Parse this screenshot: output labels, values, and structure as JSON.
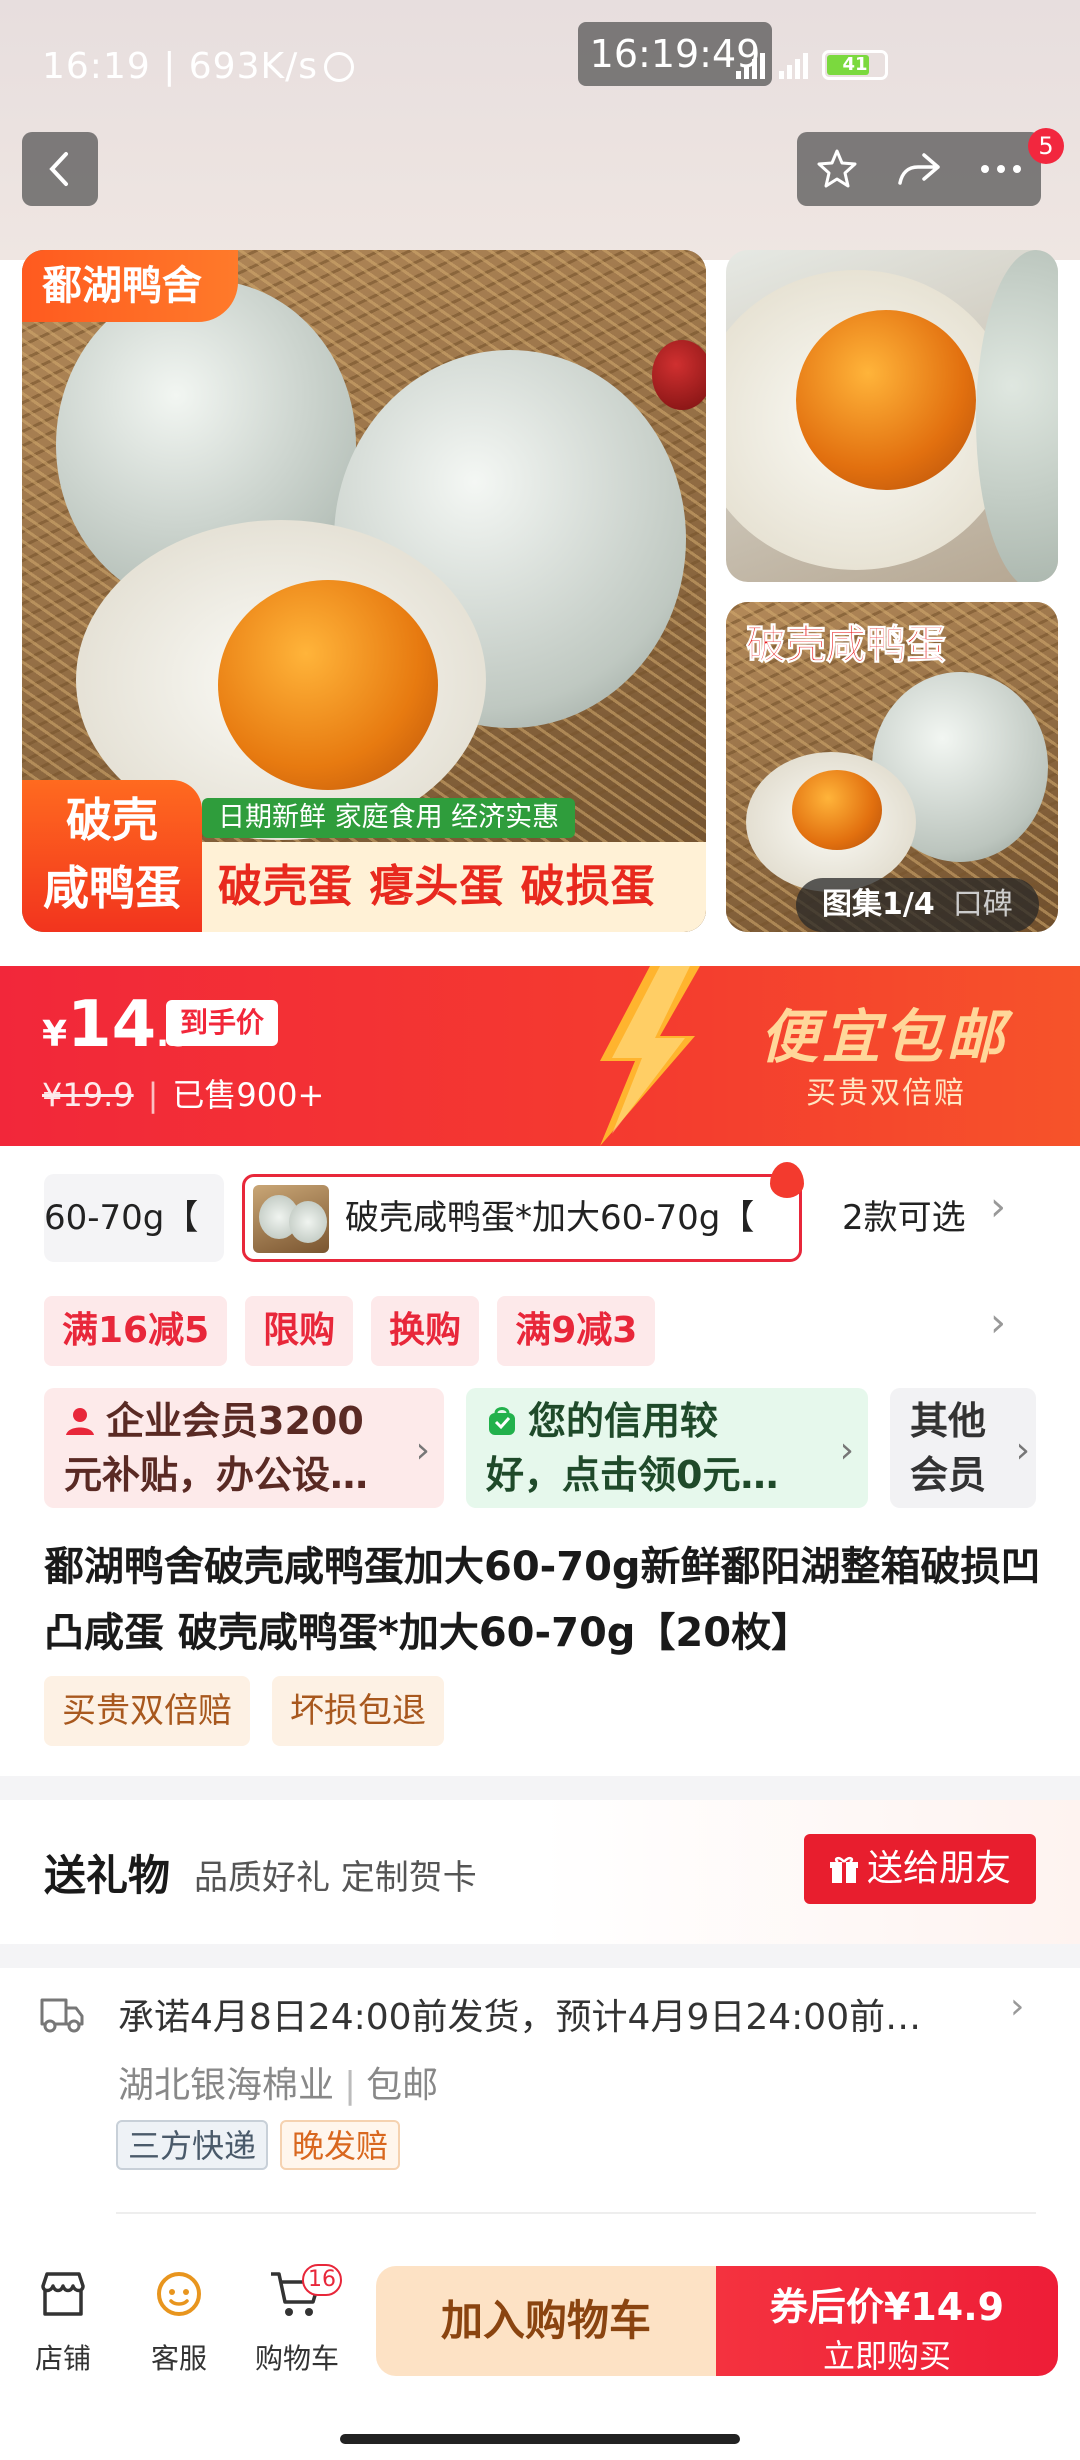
{
  "status_bar": {
    "time": "16:19",
    "speed": "693K/s",
    "clock_overlay": "16:19:49",
    "battery": "41"
  },
  "header": {
    "notification_count": "5"
  },
  "images": {
    "brand": "鄱湖鸭舍",
    "sub_banner": "日期新鲜 家庭食用 经济实惠",
    "big_label_line1": "破壳",
    "big_label_line2": "咸鸭蛋",
    "bottom_strip": "破壳蛋 瘪头蛋 破损蛋",
    "side2_title": "破壳咸鸭蛋",
    "gallery_label": "图集1/4",
    "gallery_word": "口碑"
  },
  "price": {
    "currency": "¥",
    "integer": "14",
    "decimal": ".9",
    "tag": "到手价",
    "original": "¥19.9",
    "sold": "已售900+",
    "promo_title": "便宜包邮",
    "promo_sub": "买贵双倍赔"
  },
  "sku": {
    "prev_label": "60-70g【",
    "selected_label": "破壳咸鸭蛋*加大60-70g【",
    "count_label": "2款可选"
  },
  "coupons": [
    "满16减5",
    "限购",
    "换购",
    "满9减3"
  ],
  "member_cards": {
    "enterprise_line1": "企业会员3200",
    "enterprise_line2": "元补贴，办公设…",
    "credit_line1": "您的信用较",
    "credit_line2": "好，点击领0元…",
    "other_line1": "其他",
    "other_line2": "会员"
  },
  "title": "鄱湖鸭舍破壳咸鸭蛋加大60-70g新鲜鄱阳湖整箱破损凹凸咸蛋 破壳咸鸭蛋*加大60-70g【20枚】",
  "tags": [
    "买贵双倍赔",
    "坏损包退"
  ],
  "gift": {
    "title": "送礼物",
    "subtitle": "品质好礼 定制贺卡",
    "button": "送给朋友"
  },
  "shipping": {
    "promise": "承诺4月8日24:00前发货，预计4月9日24:00前…",
    "origin": "湖北银海棉业",
    "free_shipping": "包邮",
    "tag1": "三方快递",
    "tag2": "晚发赔"
  },
  "bottom_nav": {
    "store": "店铺",
    "service": "客服",
    "cart": "购物车",
    "cart_count": "16",
    "add_cart": "加入购物车",
    "buy_line1": "券后价¥14.9",
    "buy_line2": "立即购买"
  },
  "colors": {
    "primary_red": "#f2273a",
    "accent_orange": "#ff6a1f",
    "gold": "#ffd79a"
  }
}
